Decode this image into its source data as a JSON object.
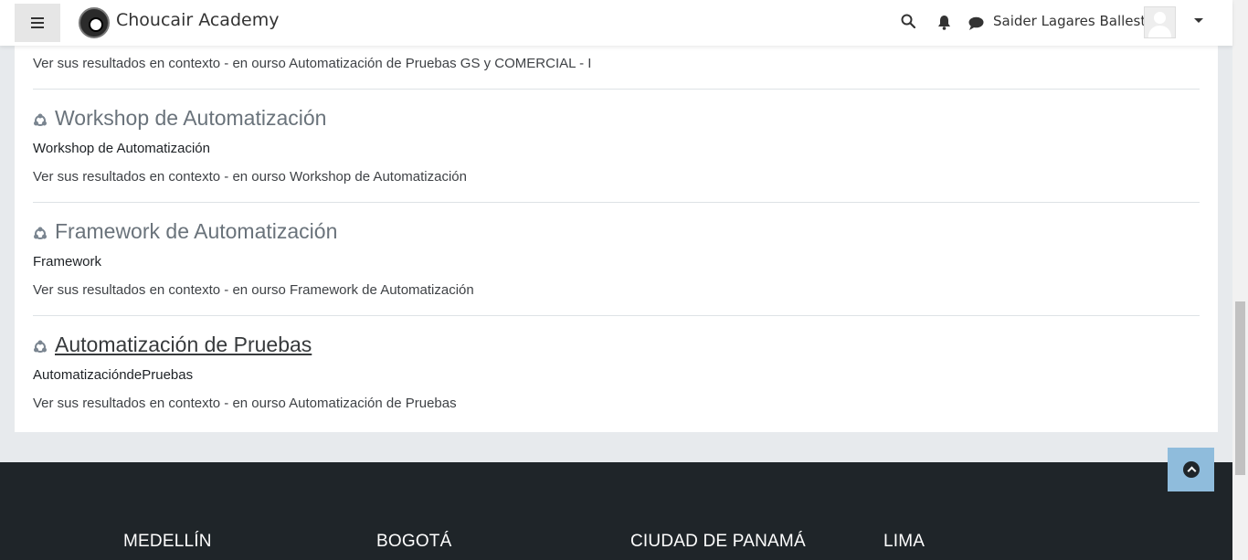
{
  "header": {
    "brand": "Choucair Academy",
    "username": "Saider Lagares Ballesta",
    "icons": [
      "menu-icon",
      "search-icon",
      "bell-icon",
      "chat-icon",
      "caret-down-icon"
    ]
  },
  "results": [
    {
      "title": "",
      "summary": "",
      "context": "Ver sus resultados en contexto - en ourso Automatización de Pruebas GS y COMERCIAL - I"
    },
    {
      "title": "Workshop de Automatización",
      "summary": "Workshop de Automatización",
      "context": "Ver sus resultados en contexto - en ourso Workshop de Automatización"
    },
    {
      "title": "Framework de Automatización",
      "summary": "Framework",
      "context": "Ver sus resultados en contexto - en ourso Framework de Automatización"
    },
    {
      "title": "Automatización de Pruebas",
      "summary": "AutomatizacióndePruebas",
      "context": "Ver sus resultados en contexto - en ourso Automatización de Pruebas"
    }
  ],
  "footer": {
    "cities": [
      "MEDELLÍN",
      "BOGOTÁ",
      "CIUDAD DE PANAMÁ",
      "LIMA"
    ]
  },
  "colors": {
    "navbar": "#ffffff",
    "page_bg": "#e7eaed",
    "footer_bg": "#1f2529",
    "back_to_top": "#8fbcdc"
  }
}
